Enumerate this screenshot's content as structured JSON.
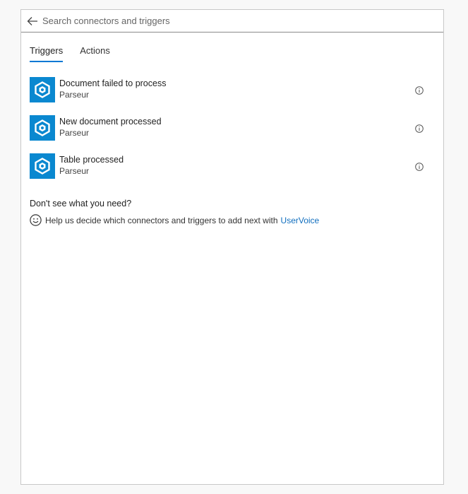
{
  "search": {
    "placeholder": "Search connectors and triggers",
    "value": ""
  },
  "tabs": [
    {
      "label": "Triggers",
      "active": true
    },
    {
      "label": "Actions",
      "active": false
    }
  ],
  "triggers": [
    {
      "title": "Document failed to process",
      "subtitle": "Parseur",
      "icon": "parseur-icon"
    },
    {
      "title": "New document processed",
      "subtitle": "Parseur",
      "icon": "parseur-icon"
    },
    {
      "title": "Table processed",
      "subtitle": "Parseur",
      "icon": "parseur-icon"
    }
  ],
  "help": {
    "title": "Don't see what you need?",
    "text": "Help us decide which connectors and triggers to add next with",
    "link": "UserVoice"
  },
  "colors": {
    "accent": "#0078d4",
    "icon_bg": "#0a88d0",
    "link": "#106ebe"
  }
}
